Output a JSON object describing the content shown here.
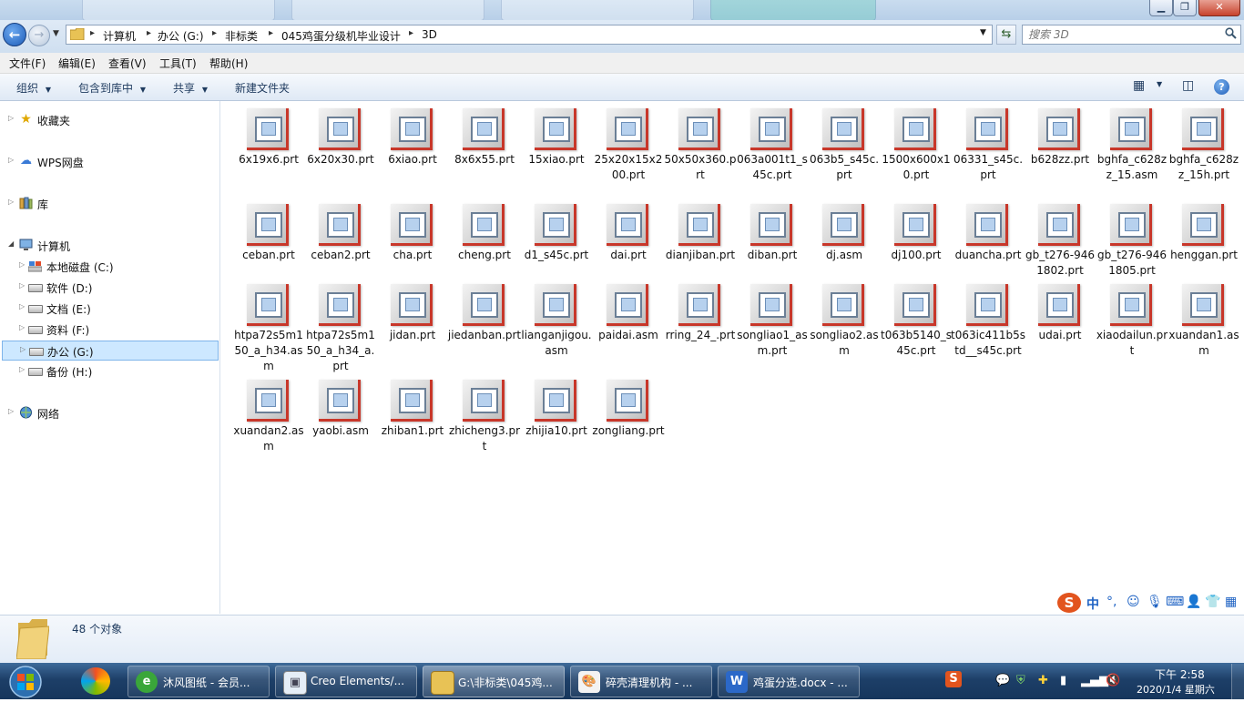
{
  "address": {
    "crumbs": [
      "计算机",
      "办公 (G:)",
      "非标类",
      "045鸡蛋分级机毕业设计",
      "3D"
    ]
  },
  "search": {
    "placeholder": "搜索 3D"
  },
  "menu": [
    "文件(F)",
    "编辑(E)",
    "查看(V)",
    "工具(T)",
    "帮助(H)"
  ],
  "toolbar": {
    "organize": "组织",
    "include": "包含到库中",
    "share": "共享",
    "new_folder": "新建文件夹"
  },
  "nav": {
    "favorites": "收藏夹",
    "wps": "WPS网盘",
    "libraries": "库",
    "computer": "计算机",
    "drives": [
      "本地磁盘 (C:)",
      "软件 (D:)",
      "文档 (E:)",
      "资料 (F:)",
      "办公 (G:)",
      "备份 (H:)"
    ],
    "network": "网络"
  },
  "files": [
    "6x19x6.prt",
    "6x20x30.prt",
    "6xiao.prt",
    "8x6x55.prt",
    "15xiao.prt",
    "25x20x15x200.prt",
    "50x50x360.prt",
    "063a001t1_s45c.prt",
    "063b5_s45c.prt",
    "1500x600x10.prt",
    "06331_s45c.prt",
    "b628zz.prt",
    "bghfa_c628zz_15.asm",
    "bghfa_c628zz_15h.prt",
    "ceban.prt",
    "ceban2.prt",
    "cha.prt",
    "cheng.prt",
    "d1_s45c.prt",
    "dai.prt",
    "dianjiban.prt",
    "diban.prt",
    "dj.asm",
    "dj100.prt",
    "duancha.prt",
    "gb_t276-9461802.prt",
    "gb_t276-9461805.prt",
    "henggan.prt",
    "htpa72s5m150_a_h34.asm",
    "htpa72s5m150_a_h34_a.prt",
    "jidan.prt",
    "jiedanban.prt",
    "lianganjigou.asm",
    "paidai.asm",
    "rring_24_.prt",
    "songliao1_asm.prt",
    "songliao2.asm",
    "t063b5140_s45c.prt",
    "t063ic411b5std__s45c.prt",
    "udai.prt",
    "xiaodailun.prt",
    "xuandan1.asm",
    "xuandan2.asm",
    "yaobi.asm",
    "zhiban1.prt",
    "zhicheng3.prt",
    "zhijia10.prt",
    "zongliang.prt"
  ],
  "status": {
    "count": "48 个对象"
  },
  "ime": {
    "lang": "中",
    "punct": "°,"
  },
  "taskbar": {
    "items": [
      "沐风图纸 - 会员...",
      "Creo Elements/...",
      "G:\\非标类\\045鸡...",
      "碎壳清理机构 - ...",
      "鸡蛋分选.docx - ..."
    ],
    "time": "下午 2:58",
    "date": "2020/1/4 星期六"
  },
  "colors": {
    "accent": "#1d5cb8",
    "selected": "#cde8ff",
    "part_icon_edge": "#c8372a"
  }
}
